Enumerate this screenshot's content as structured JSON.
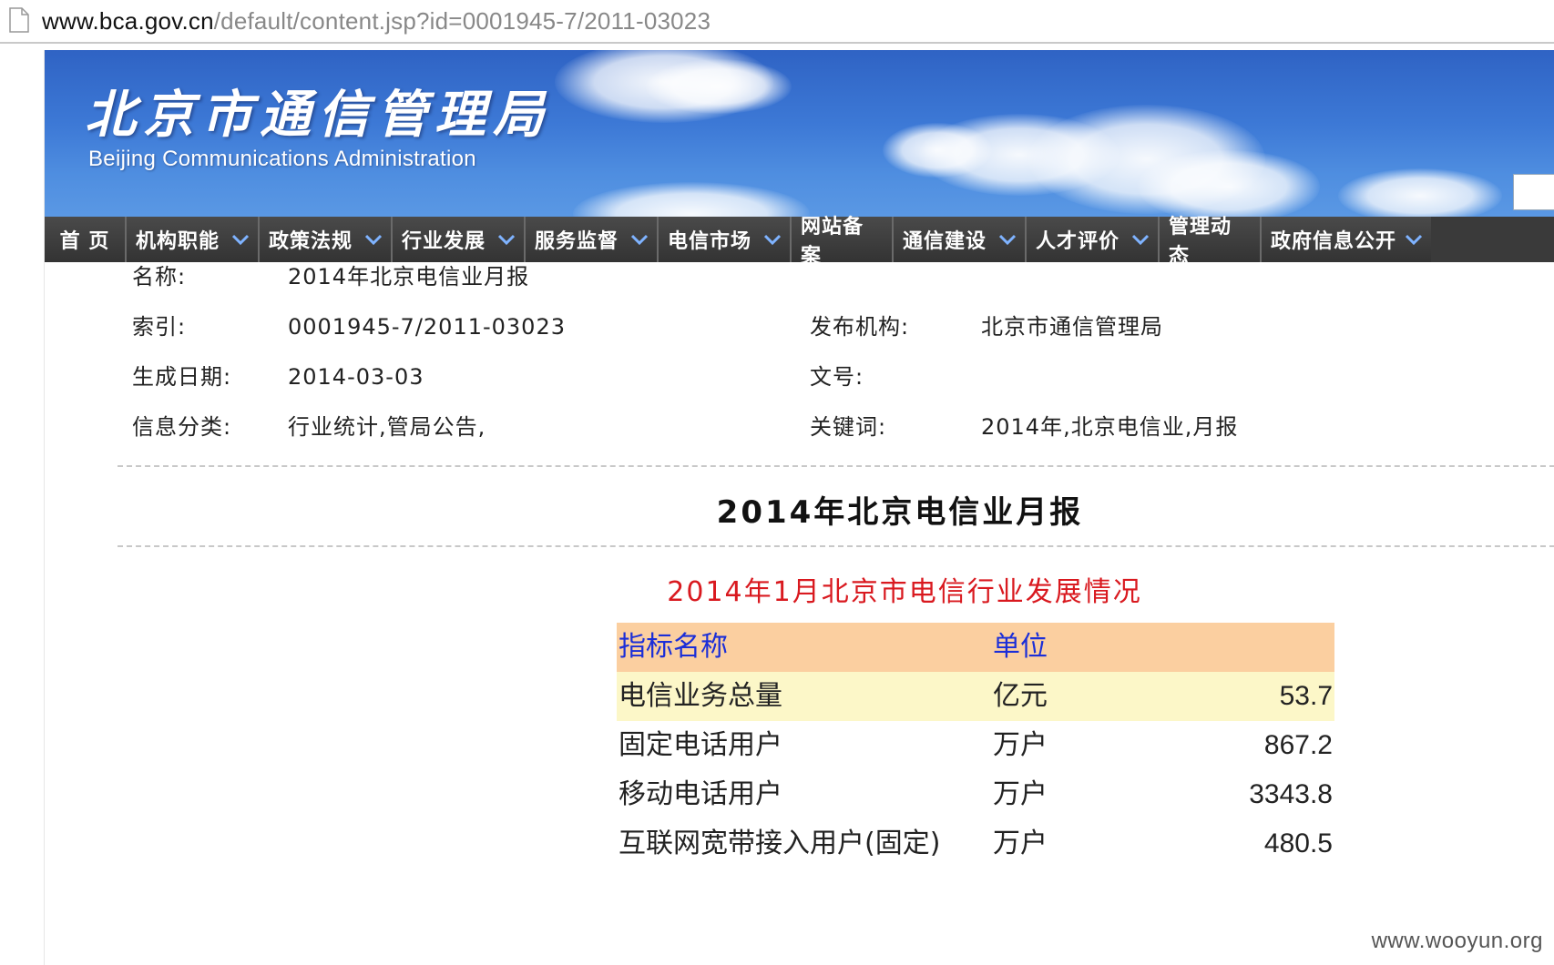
{
  "url": {
    "host": "www.bca.gov.cn",
    "path": "/default/content.jsp?id=0001945-7/2011-03023"
  },
  "banner": {
    "title_cn": "北京市通信管理局",
    "title_en": "Beijing Communications Administration"
  },
  "nav": [
    {
      "label": "首 页",
      "dropdown": false
    },
    {
      "label": "机构职能",
      "dropdown": true
    },
    {
      "label": "政策法规",
      "dropdown": true
    },
    {
      "label": "行业发展",
      "dropdown": true
    },
    {
      "label": "服务监督",
      "dropdown": true
    },
    {
      "label": "电信市场",
      "dropdown": true
    },
    {
      "label": "网站备案",
      "dropdown": false
    },
    {
      "label": "通信建设",
      "dropdown": true
    },
    {
      "label": "人才评价",
      "dropdown": true
    },
    {
      "label": "管理动态",
      "dropdown": false
    },
    {
      "label": "政府信息公开",
      "dropdown": true
    }
  ],
  "meta": {
    "name_label": "名称:",
    "name_value": "2014年北京电信业月报",
    "index_label": "索引:",
    "index_value": "0001945-7/2011-03023",
    "publisher_label": "发布机构:",
    "publisher_value": "北京市通信管理局",
    "date_label": "生成日期:",
    "date_value": "2014-03-03",
    "docno_label": "文号:",
    "docno_value": "",
    "category_label": "信息分类:",
    "category_value": "行业统计,管局公告,",
    "keywords_label": "关键词:",
    "keywords_value": "2014年,北京电信业,月报"
  },
  "document": {
    "title": "2014年北京电信业月报",
    "subtitle": "2014年1月北京市电信行业发展情况"
  },
  "table": {
    "headers": [
      "指标名称",
      "单位",
      ""
    ],
    "rows": [
      [
        "电信业务总量",
        "亿元",
        "53.7"
      ],
      [
        "固定电话用户",
        "万户",
        "867.2"
      ],
      [
        "移动电话用户",
        "万户",
        "3343.8"
      ],
      [
        "互联网宽带接入用户(固定)",
        "万户",
        "480.5"
      ]
    ]
  },
  "watermark": "www.wooyun.org",
  "colors": {
    "nav_bg": "#3a3a3a",
    "header_row": "#fbcfa0",
    "highlight_row": "#fcf7c8",
    "subtitle": "#d9191f",
    "header_text": "#1b2ed8"
  }
}
